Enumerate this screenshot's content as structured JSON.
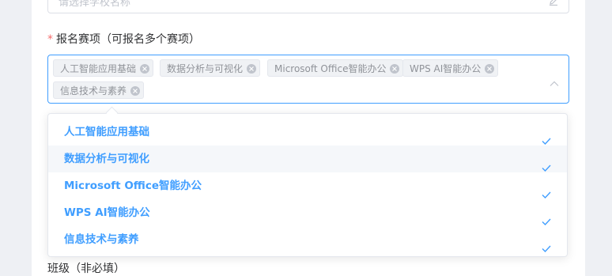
{
  "school_field": {
    "placeholder": "请选择学校名称",
    "icon": "edit-icon"
  },
  "events_field": {
    "required_mark": "*",
    "label": "报名赛项（可报名多个赛项）",
    "selected_tags": [
      "人工智能应用基础",
      "数据分析与可视化",
      "Microsoft Office智能办公",
      "WPS AI智能办公",
      "信息技术与素养"
    ],
    "options": [
      {
        "label": "人工智能应用基础",
        "selected": true
      },
      {
        "label": "数据分析与可视化",
        "selected": true,
        "hovered": true
      },
      {
        "label": "Microsoft Office智能办公",
        "selected": true
      },
      {
        "label": "WPS AI智能办公",
        "selected": true
      },
      {
        "label": "信息技术与素养",
        "selected": true
      }
    ]
  },
  "class_field": {
    "label": "班级（非必填）"
  },
  "colors": {
    "accent": "#409eff",
    "required": "#f56c6c",
    "tag_bg": "#f0f2f5",
    "tag_text": "#909399"
  }
}
